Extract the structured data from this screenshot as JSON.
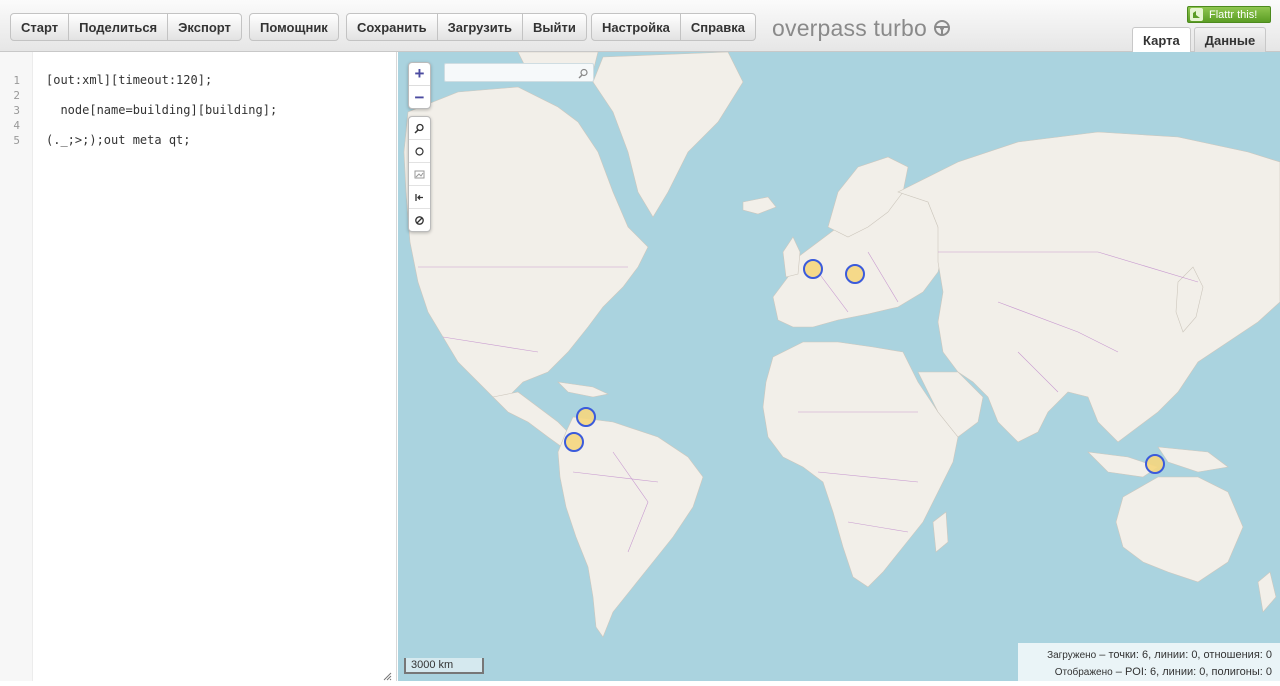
{
  "toolbar": {
    "group1": [
      "Старт",
      "Поделиться",
      "Экспорт"
    ],
    "group2": [
      "Помощник"
    ],
    "group3": [
      "Сохранить",
      "Загрузить",
      "Выйти"
    ],
    "group4": [
      "Настройка",
      "Справка"
    ]
  },
  "logo": {
    "text": "overpass turbo"
  },
  "flattr": {
    "label": "Flattr this!"
  },
  "tabs": {
    "map": "Карта",
    "data": "Данные",
    "active": "map"
  },
  "editor": {
    "line_numbers": [
      "1",
      "2",
      "3",
      "4",
      "5"
    ],
    "lines": [
      "[out:xml][timeout:120];",
      "",
      "  node[name=building][building];",
      "",
      "(._;>;);out meta qt;"
    ]
  },
  "map": {
    "zoom_in": "+",
    "zoom_out": "−",
    "tools": [
      "search-icon",
      "circle-icon",
      "image-icon",
      "zoom-to-data-icon",
      "cancel-icon"
    ],
    "scale_label": "3000 km",
    "colors": {
      "water": "#aad3df",
      "land": "#f2efe9",
      "border": "#c89ad0",
      "marker_fill": "#f5d67e",
      "marker_stroke": "#3b5bdb"
    },
    "stats": {
      "loaded_prefix": "Загружено",
      "loaded_text": "– точки: 6, линии: 0, отношения: 0",
      "shown_prefix": "Отображено",
      "shown_text": "– POI: 6, линии: 0, полигоны: 0"
    }
  }
}
